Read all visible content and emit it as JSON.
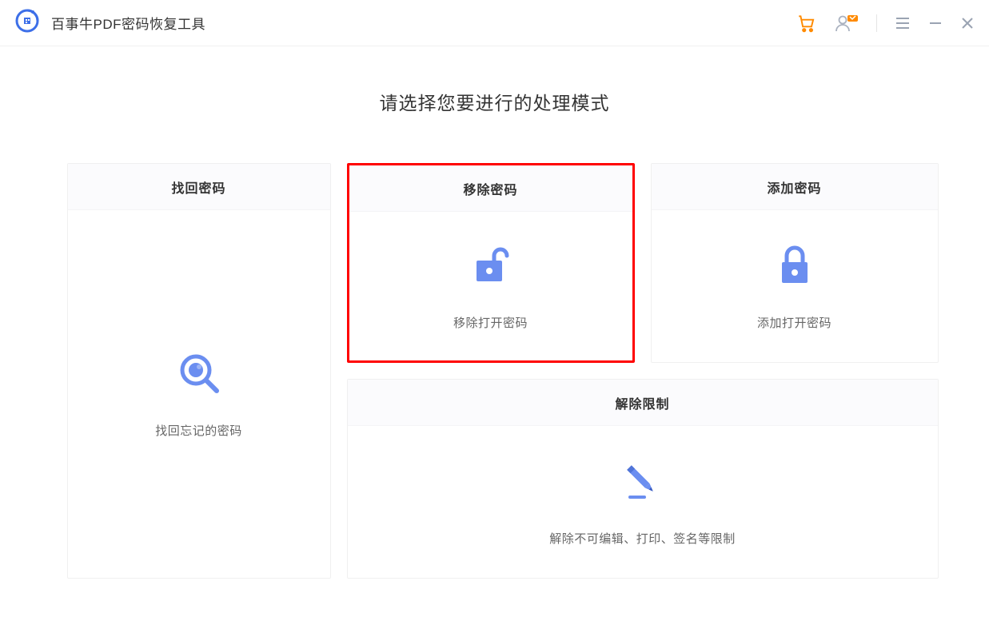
{
  "app": {
    "title": "百事牛PDF密码恢复工具"
  },
  "instruction": "请选择您要进行的处理模式",
  "cards": {
    "recover": {
      "title": "找回密码",
      "desc": "找回忘记的密码"
    },
    "remove": {
      "title": "移除密码",
      "desc": "移除打开密码"
    },
    "add": {
      "title": "添加密码",
      "desc": "添加打开密码"
    },
    "restrict": {
      "title": "解除限制",
      "desc": "解除不可编辑、打印、签名等限制"
    }
  }
}
